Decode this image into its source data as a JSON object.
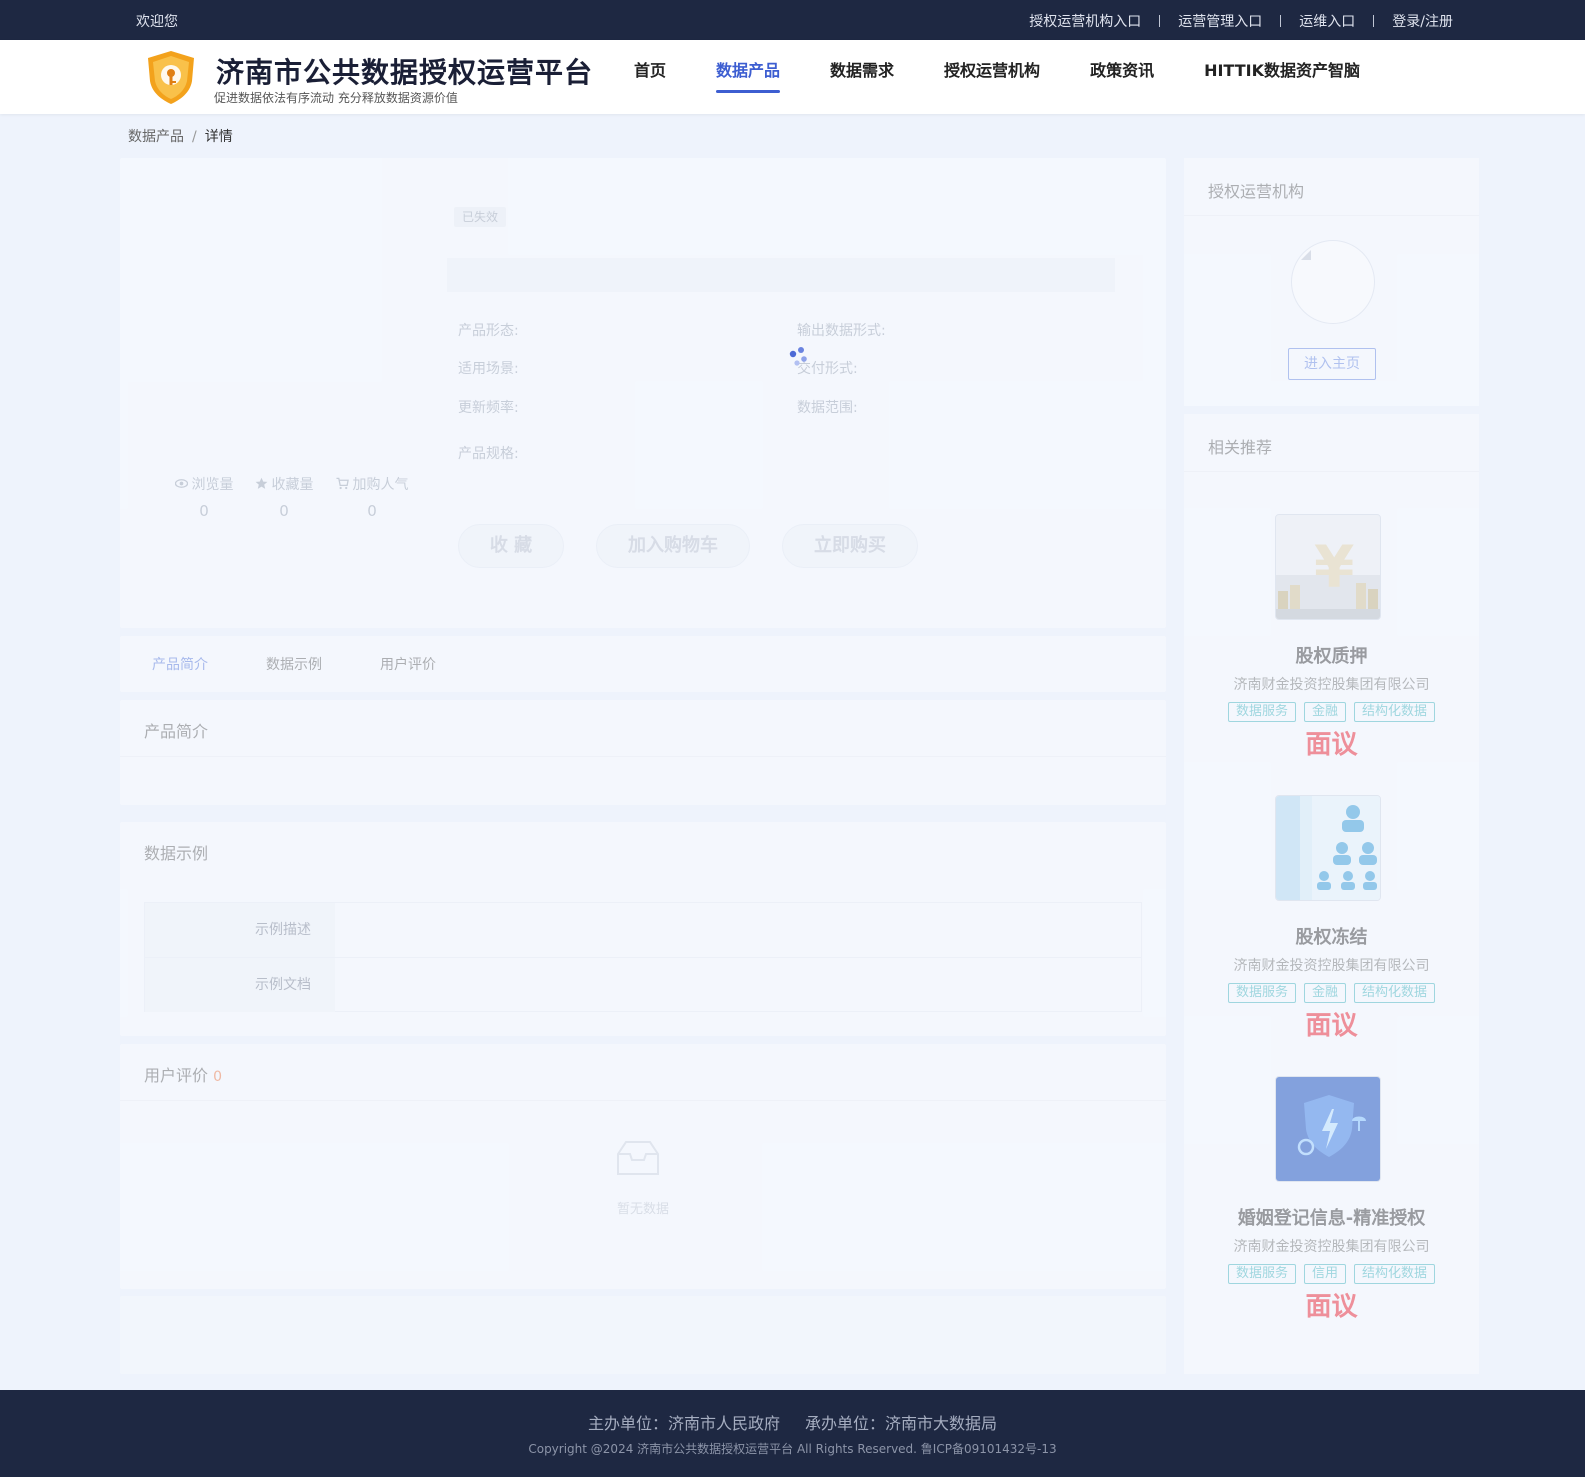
{
  "topbar": {
    "welcome": "欢迎您",
    "links": [
      "授权运营机构入口",
      "运营管理入口",
      "运维入口",
      "登录/注册"
    ]
  },
  "header": {
    "title": "济南市公共数据授权运营平台",
    "subtitle": "促进数据依法有序流动 充分释放数据资源价值",
    "nav": [
      {
        "label": "首页",
        "active": false
      },
      {
        "label": "数据产品",
        "active": true
      },
      {
        "label": "数据需求",
        "active": false
      },
      {
        "label": "授权运营机构",
        "active": false
      },
      {
        "label": "政策资讯",
        "active": false
      },
      {
        "label": "HITTIK数据资产智脑",
        "active": false
      }
    ]
  },
  "breadcrumb": {
    "parent": "数据产品",
    "separator": "/",
    "current": "详情"
  },
  "product": {
    "status_badge": "已失效",
    "attributes": {
      "form": "产品形态:",
      "output_format": "输出数据形式:",
      "scenario": "适用场景:",
      "delivery": "交付形式:",
      "update_freq": "更新频率:",
      "data_range": "数据范围:",
      "spec": "产品规格:"
    },
    "stats": [
      {
        "label": "浏览量",
        "value": "0",
        "icon": "eye-icon"
      },
      {
        "label": "收藏量",
        "value": "0",
        "icon": "star-icon"
      },
      {
        "label": "加购人气",
        "value": "0",
        "icon": "cart-icon"
      }
    ],
    "buttons": {
      "favorite": "收 藏",
      "add_cart": "加入购物车",
      "buy_now": "立即购买"
    }
  },
  "tabs": [
    "产品简介",
    "数据示例",
    "用户评价"
  ],
  "sections": {
    "intro_title": "产品简介",
    "sample_title": "数据示例",
    "sample_rows": [
      "示例描述",
      "示例文档"
    ],
    "review_title": "用户评价",
    "review_count": "0",
    "empty_text": "暂无数据"
  },
  "sidebar": {
    "org_title": "授权运营机构",
    "org_button": "进入主页",
    "rec_title": "相关推荐",
    "recommendations": [
      {
        "name": "股权质押",
        "company": "济南财金投资控股集团有限公司",
        "tags": [
          "数据服务",
          "金融",
          "结构化数据"
        ],
        "price": "面议",
        "image": "yen-coins-image"
      },
      {
        "name": "股权冻结",
        "company": "济南财金投资控股集团有限公司",
        "tags": [
          "数据服务",
          "金融",
          "结构化数据"
        ],
        "price": "面议",
        "image": "people-org-image"
      },
      {
        "name": "婚姻登记信息-精准授权",
        "company": "济南财金投资控股集团有限公司",
        "tags": [
          "数据服务",
          "信用",
          "结构化数据"
        ],
        "price": "面议",
        "image": "security-shield-image"
      }
    ]
  },
  "footer": {
    "sponsor": "主办单位：济南市人民政府",
    "organizer": "承办单位：济南市大数据局",
    "copyright": "Copyright @2024 济南市公共数据授权运营平台 All Rights Reserved. 鲁ICP备09101432号-13"
  },
  "colors": {
    "topbar_bg": "#1e2842",
    "accent": "#3d5ed1",
    "price": "#ee3e4b",
    "tag": "#5fc0c8"
  }
}
